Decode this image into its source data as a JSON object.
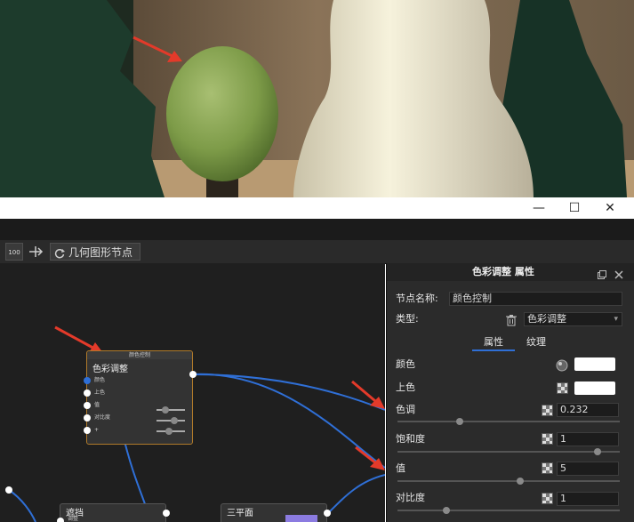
{
  "window": {
    "minimize_glyph": "—",
    "maximize_glyph": "☐",
    "close_glyph": "✕"
  },
  "toolbar": {
    "zoom_label": "100",
    "geometry_node_button": "几何图形节点"
  },
  "graph": {
    "node_color_adjust": {
      "header": "颜色控制",
      "title": "色彩调整",
      "ports": [
        "颜色",
        "上色",
        "值",
        "对比度",
        "+"
      ]
    },
    "node_mask": {
      "title": "遮挡",
      "port": "调整"
    },
    "node_plane": {
      "title": "三平面"
    }
  },
  "panel": {
    "title": "色彩调整  属性",
    "node_name_label": "节点名称:",
    "node_name_value": "颜色控制",
    "type_label": "类型:",
    "type_value": "色彩调整",
    "tabs": [
      "属性",
      "纹理"
    ],
    "active_tab": 0,
    "props": {
      "color": {
        "label": "颜色",
        "value": "#ffffff"
      },
      "tint": {
        "label": "上色",
        "value": "#ffffff"
      },
      "hue": {
        "label": "色调",
        "value": "0.232",
        "slider_fraction": 0.28
      },
      "saturation": {
        "label": "饱和度",
        "value": "1",
        "slider_fraction": 0.9
      },
      "value": {
        "label": "值",
        "value": "5",
        "slider_fraction": 0.55
      },
      "contrast": {
        "label": "对比度",
        "value": "1",
        "slider_fraction": 0.22
      }
    }
  },
  "colors": {
    "accent_blue": "#2f6fd6",
    "annotation_arrow": "#e33a2a",
    "node_border_selected": "#b07a2a"
  }
}
